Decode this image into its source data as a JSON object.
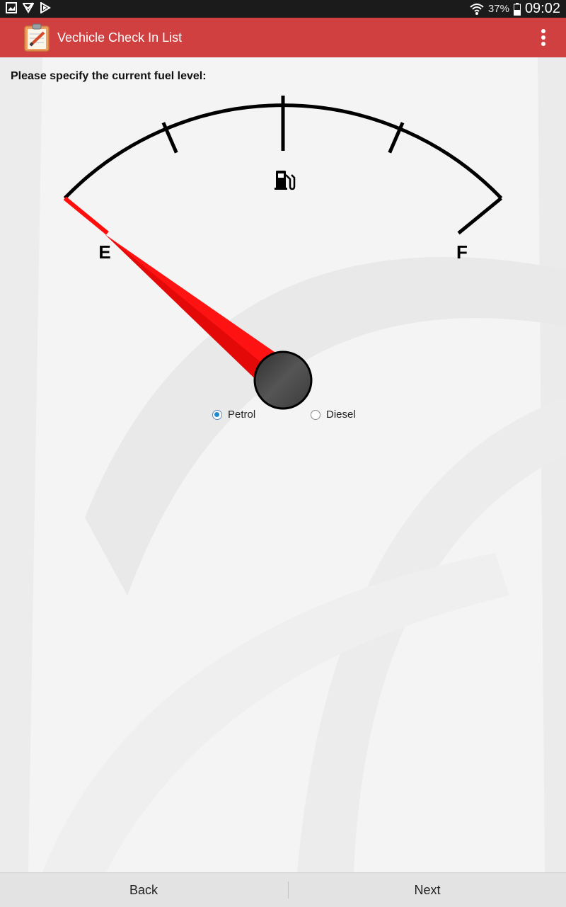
{
  "status_bar": {
    "battery_percent": "37%",
    "time": "09:02"
  },
  "app_bar": {
    "title": "Vechicle Check In List"
  },
  "fuel": {
    "prompt": "Please specify the current fuel level:",
    "empty_label": "E",
    "full_label": "F",
    "level_fraction": 0.0,
    "fuel_types": [
      {
        "label": "Petrol",
        "checked": true
      },
      {
        "label": "Diesel",
        "checked": false
      }
    ]
  },
  "bottom": {
    "back_label": "Back",
    "next_label": "Next"
  },
  "colors": {
    "app_bar": "#d04040",
    "needle": "#ff1212",
    "radio_accent": "#1e88d0"
  }
}
